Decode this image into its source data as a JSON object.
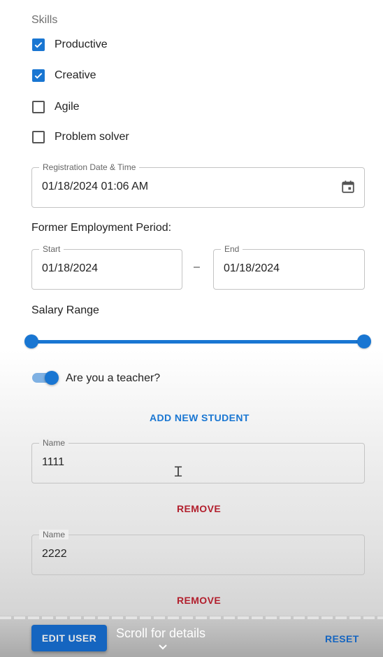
{
  "skills": {
    "title": "Skills",
    "items": [
      {
        "label": "Productive",
        "checked": true
      },
      {
        "label": "Creative",
        "checked": true
      },
      {
        "label": "Agile",
        "checked": false
      },
      {
        "label": "Problem solver",
        "checked": false
      }
    ]
  },
  "registration": {
    "label": "Registration Date & Time",
    "value": "01/18/2024 01:06 AM",
    "icon": "calendar-icon"
  },
  "employment": {
    "title": "Former Employment Period:",
    "start_label": "Start",
    "start_value": "01/18/2024",
    "separator": "–",
    "end_label": "End",
    "end_value": "01/18/2024"
  },
  "salary": {
    "title": "Salary Range",
    "min_fraction": 0,
    "max_fraction": 1
  },
  "teacher": {
    "label": "Are you a teacher?",
    "on": true
  },
  "students": {
    "add_label": "ADD NEW STUDENT",
    "items": [
      {
        "label": "Name",
        "value": "1111",
        "remove_label": "REMOVE"
      },
      {
        "label": "Name",
        "value": "2222",
        "remove_label": "REMOVE"
      }
    ]
  },
  "footer": {
    "edit_label": "EDIT USER",
    "scroll_hint": "Scroll for details",
    "reset_label": "RESET"
  },
  "colors": {
    "primary": "#1976d2",
    "danger": "#b21f2d"
  }
}
